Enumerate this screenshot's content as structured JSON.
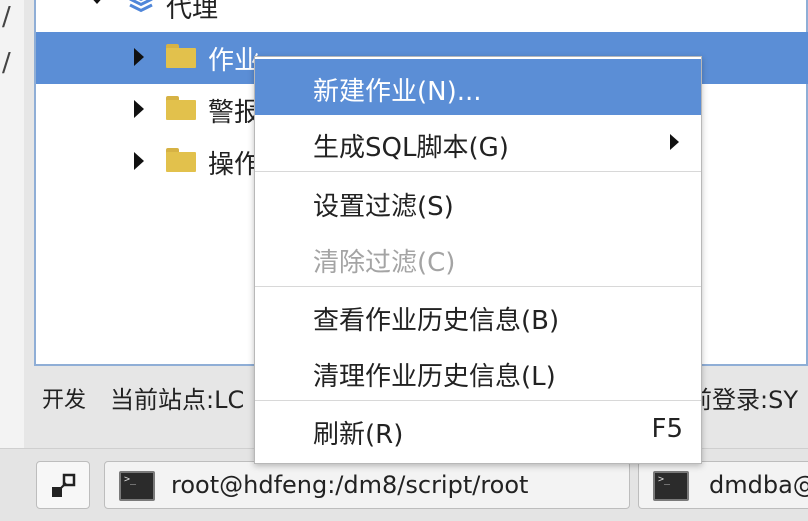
{
  "left_panel": {
    "glyph": "/"
  },
  "tree": {
    "root": {
      "label": "代理"
    },
    "items": [
      {
        "label": "作业",
        "selected": true
      },
      {
        "label": "警报"
      },
      {
        "label": "操作"
      }
    ]
  },
  "status_bar": {
    "mode": "开发",
    "site": "当前站点:LC",
    "login": "前登录:SY"
  },
  "context_menu": {
    "items": [
      {
        "label": "新建作业(N)...",
        "highlighted": true
      },
      {
        "label": "生成SQL脚本(G)",
        "submenu": true
      },
      {
        "label": "设置过滤(S)"
      },
      {
        "label": "清除过滤(C)",
        "disabled": true
      },
      {
        "label": "查看作业历史信息(B)"
      },
      {
        "label": "清理作业历史信息(L)"
      },
      {
        "label": "刷新(R)",
        "shortcut": "F5"
      }
    ]
  },
  "taskbar": {
    "items": [
      {
        "label": "root@hdfeng:/dm8/script/root"
      },
      {
        "label": "dmdba@"
      }
    ]
  },
  "colors": {
    "selection": "#5b8ed6",
    "folder": "#e2c14c",
    "layers_icon": "#4f86d9"
  }
}
